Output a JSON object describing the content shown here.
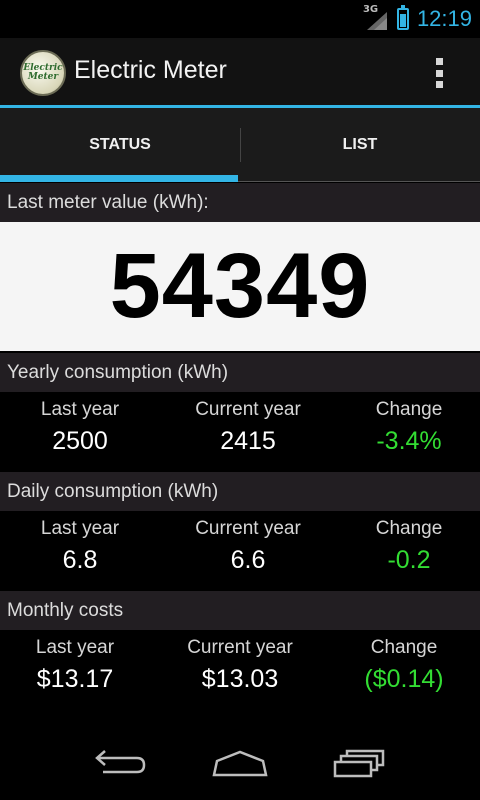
{
  "status_bar": {
    "network": "3G",
    "time": "12:19",
    "accent": "#33b5e5"
  },
  "app": {
    "title": "Electric Meter",
    "logo_text": "Electric Meter"
  },
  "tabs": [
    {
      "label": "STATUS",
      "selected": true
    },
    {
      "label": "LIST",
      "selected": false
    }
  ],
  "meter": {
    "header": "Last meter value (kWh):",
    "value": "54349"
  },
  "yearly": {
    "header": "Yearly consumption (kWh)",
    "last_label": "Last year",
    "last_value": "2500",
    "current_label": "Current year",
    "current_value": "2415",
    "change_label": "Change",
    "change_value": "-3.4%"
  },
  "daily": {
    "header": "Daily consumption (kWh)",
    "last_label": "Last year",
    "last_value": "6.8",
    "current_label": "Current year",
    "current_value": "6.6",
    "change_label": "Change",
    "change_value": "-0.2"
  },
  "monthly": {
    "header": "Monthly costs",
    "last_label": "Last year",
    "last_value": "$13.17",
    "current_label": "Current year",
    "current_value": "$13.03",
    "change_label": "Change",
    "change_value": "($0.14)"
  },
  "colors": {
    "positive_change": "#33dd33",
    "section_header_bg": "#221e22"
  },
  "nav": {
    "back_icon": "back-icon",
    "home_icon": "home-icon",
    "recents_icon": "recents-icon"
  }
}
